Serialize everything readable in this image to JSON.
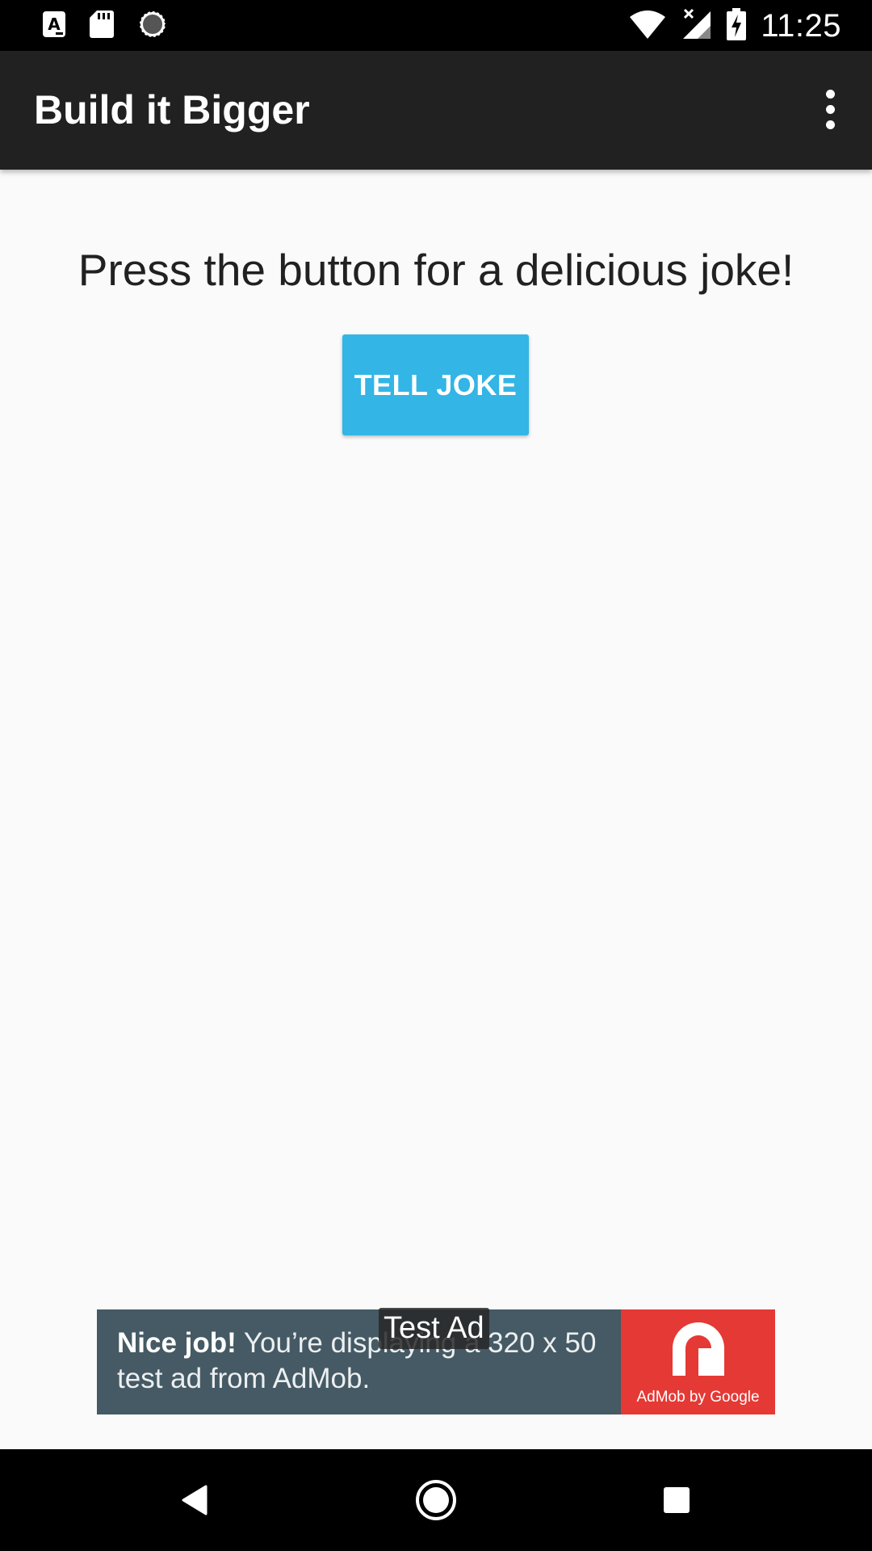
{
  "status_bar": {
    "time": "11:25",
    "left_icons": [
      "font-a-icon",
      "sd-card-icon",
      "loading-spinner-icon"
    ],
    "right_icons": [
      "wifi-icon",
      "cellular-no-signal-icon",
      "battery-charging-icon"
    ]
  },
  "app_bar": {
    "title": "Build it Bigger",
    "overflow_icon": "more-vert-icon"
  },
  "main": {
    "instructions": "Press the button for a delicious joke!",
    "tell_joke_label": "TELL JOKE"
  },
  "ad_banner": {
    "badge": "Test Ad",
    "headline": "Nice job!",
    "body_line1": " You’re displaying a 320 x 50",
    "body_line2": "test ad from AdMob.",
    "logo_caption": "AdMob by Google"
  },
  "nav_bar": {
    "icons": [
      "back-icon",
      "home-icon",
      "recents-icon"
    ]
  },
  "colors": {
    "app_bar": "#212121",
    "button": "#33b5e5",
    "ad_background": "#455a64",
    "ad_logo": "#e53935",
    "page_background": "#fafafa"
  }
}
